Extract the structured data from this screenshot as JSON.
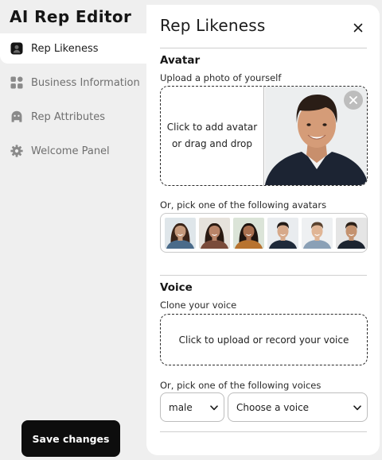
{
  "app": {
    "title": "AI Rep Editor"
  },
  "sidebar": {
    "items": [
      {
        "label": "Rep Likeness",
        "icon": "rep-likeness-icon",
        "active": true
      },
      {
        "label": "Business Information",
        "icon": "grid-icon",
        "active": false
      },
      {
        "label": "Rep Attributes",
        "icon": "rep-attributes-icon",
        "active": false
      },
      {
        "label": "Welcome Panel",
        "icon": "gear-icon",
        "active": false
      }
    ],
    "save_label": "Save changes"
  },
  "panel": {
    "title": "Rep Likeness",
    "close_icon": "close-icon",
    "avatar": {
      "heading": "Avatar",
      "upload_caption": "Upload a photo of yourself",
      "drop_text_line1": "Click to add avatar",
      "drop_text_line2": "or drag and drop",
      "pick_caption": "Or, pick one of the following avatars",
      "options": [
        {
          "skin": "#c69a7c",
          "hair": "#3a2418",
          "shirt": "#4a6b8a",
          "bg": "#dfe6ea"
        },
        {
          "skin": "#b98468",
          "hair": "#2a1a12",
          "shirt": "#7a4b3a",
          "bg": "#e6e2dc"
        },
        {
          "skin": "#a86f4f",
          "hair": "#1e1410",
          "shirt": "#b8732f",
          "bg": "#dbe4d8"
        },
        {
          "skin": "#d7a98a",
          "hair": "#221a16",
          "shirt": "#1f2a3a",
          "bg": "#e9ecef"
        },
        {
          "skin": "#e0b595",
          "hair": "#5a4330",
          "shirt": "#8aa0b6",
          "bg": "#eef0f2"
        },
        {
          "skin": "#c4926f",
          "hair": "#2c2018",
          "shirt": "#1c2430",
          "bg": "#e5e5e5"
        }
      ]
    },
    "voice": {
      "heading": "Voice",
      "clone_caption": "Clone your voice",
      "upload_text": "Click to upload or record your voice",
      "pick_caption": "Or, pick one of the following voices",
      "gender_value": "male",
      "voice_placeholder": "Choose a voice"
    }
  },
  "colors": {
    "accent": "#0d0d0d",
    "panel_bg": "#ffffff",
    "app_bg": "#efefef"
  }
}
